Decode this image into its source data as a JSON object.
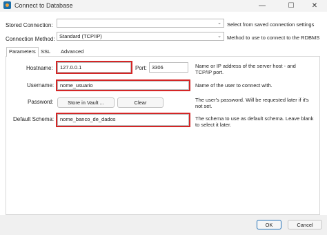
{
  "window": {
    "title": "Connect to Database",
    "min_glyph": "—",
    "max_glyph": "☐",
    "close_glyph": "✕"
  },
  "stored_connection": {
    "label": "Stored Connection:",
    "value": "",
    "hint": "Select from saved connection settings"
  },
  "connection_method": {
    "label": "Connection Method:",
    "value": "Standard (TCP/IP)",
    "hint": "Method to use to connect to the RDBMS"
  },
  "tabs": [
    {
      "label": "Parameters"
    },
    {
      "label": "SSL"
    },
    {
      "label": "Advanced"
    }
  ],
  "params": {
    "hostname": {
      "label": "Hostname:",
      "value": "127.0.0.1",
      "hint": "Name or IP address of the server host - and TCP/IP port."
    },
    "port": {
      "label": "Port:",
      "value": "3306"
    },
    "username": {
      "label": "Username:",
      "value": "nome_usuario",
      "hint": "Name of the user to connect with."
    },
    "password": {
      "label": "Password:",
      "store_button": "Store in Vault ...",
      "clear_button": "Clear",
      "hint": "The user's password. Will be requested later if it's not set."
    },
    "default_schema": {
      "label": "Default Schema:",
      "value": "nome_banco_de_dados",
      "hint": "The schema to use as default schema. Leave blank to select it later."
    }
  },
  "footer": {
    "ok": "OK",
    "cancel": "Cancel"
  },
  "colors": {
    "highlight": "#d42626",
    "accent": "#1f6fb6"
  },
  "icons": [
    "app-icon",
    "chevron-down-icon"
  ]
}
